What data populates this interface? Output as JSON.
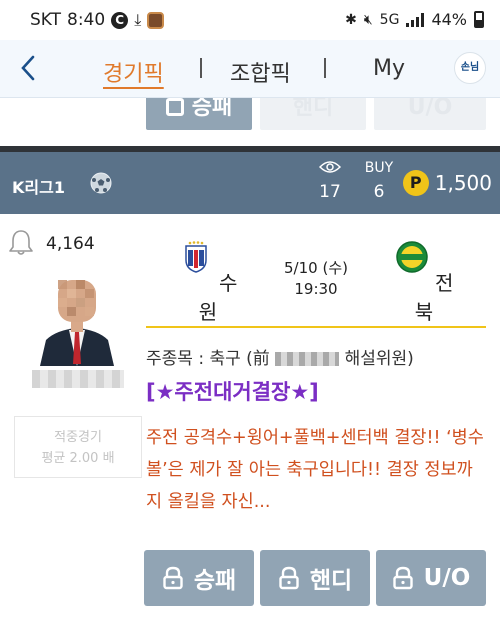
{
  "status_bar": {
    "carrier": "SKT",
    "time": "8:40",
    "network": "5G",
    "battery": "44%"
  },
  "nav": {
    "tabs": [
      "경기픽",
      "조합픽",
      "My"
    ],
    "active_tab": "경기픽",
    "avatar_label": "손님"
  },
  "prev_card": {
    "buttons": [
      "승패",
      "핸디",
      "U/O"
    ]
  },
  "card": {
    "league": "K리그1",
    "views_value": "17",
    "buy_label": "BUY",
    "buy_value": "6",
    "price": "1,500",
    "coin_symbol": "P",
    "likes": "4,164",
    "hit_rate_line1": "적중경기",
    "hit_rate_line2": "평균 2.00 배",
    "home_team": "수원",
    "away_team": "전북",
    "date": "5/10 (수)",
    "time": "19:30",
    "category_prefix": "주종목 : 축구 (前 ",
    "category_suffix": " 해설위원)",
    "headline": "[★주전대거결장★]",
    "description": "주전 공격수+윙어+풀백+센터백 결장!! ‘병수볼’은 제가 잘 아는 축구입니다!! 결장 정보까지 올킬을 자신...",
    "buttons": [
      "승패",
      "핸디",
      "U/O"
    ]
  },
  "colors": {
    "accent": "#e07a2c",
    "header_bg": "#5a7289",
    "button_bg": "#91a4b4",
    "headline": "#7b2ec4",
    "description": "#d0501f",
    "coin": "#f0c419"
  }
}
